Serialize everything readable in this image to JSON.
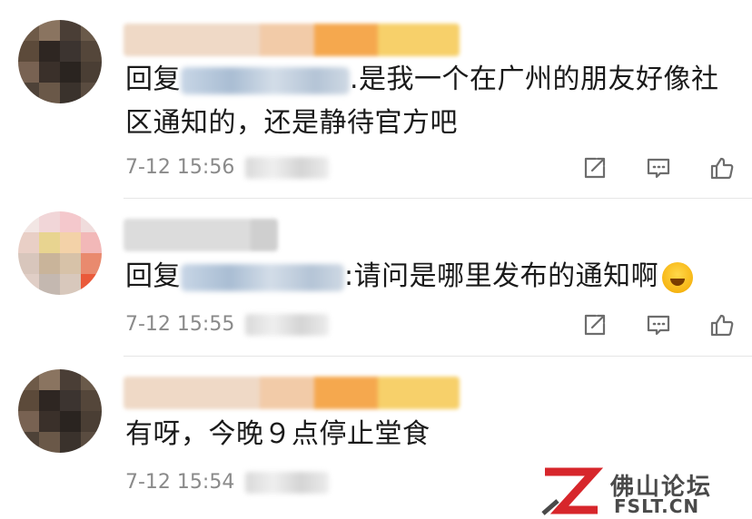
{
  "comments": [
    {
      "reply_prefix": "回复",
      "text_line1": ".是我一个在广州的朋友好像社",
      "text_line2": "区通知的，还是静待官方吧",
      "timestamp": "7-12 15:56"
    },
    {
      "reply_prefix": "回复",
      "text_line1": ":请问是哪里发布的通知啊",
      "timestamp": "7-12 15:55",
      "emoji": "laughing-crying-emoji"
    },
    {
      "text_line1": "有呀，今晚９点停止堂食",
      "timestamp": "7-12 15:54"
    }
  ],
  "actions": {
    "share_icon": "share-icon",
    "comment_icon": "comment-icon",
    "like_icon": "thumbs-up-icon"
  },
  "watermark": {
    "cn": "佛山论坛",
    "en": "FSLT.CN",
    "logo_color": "#d7262b"
  },
  "colors": {
    "text": "#1a1a1a",
    "meta": "#8a8a8a",
    "icon": "#6d6d6d",
    "divider": "#e6e6e6"
  }
}
